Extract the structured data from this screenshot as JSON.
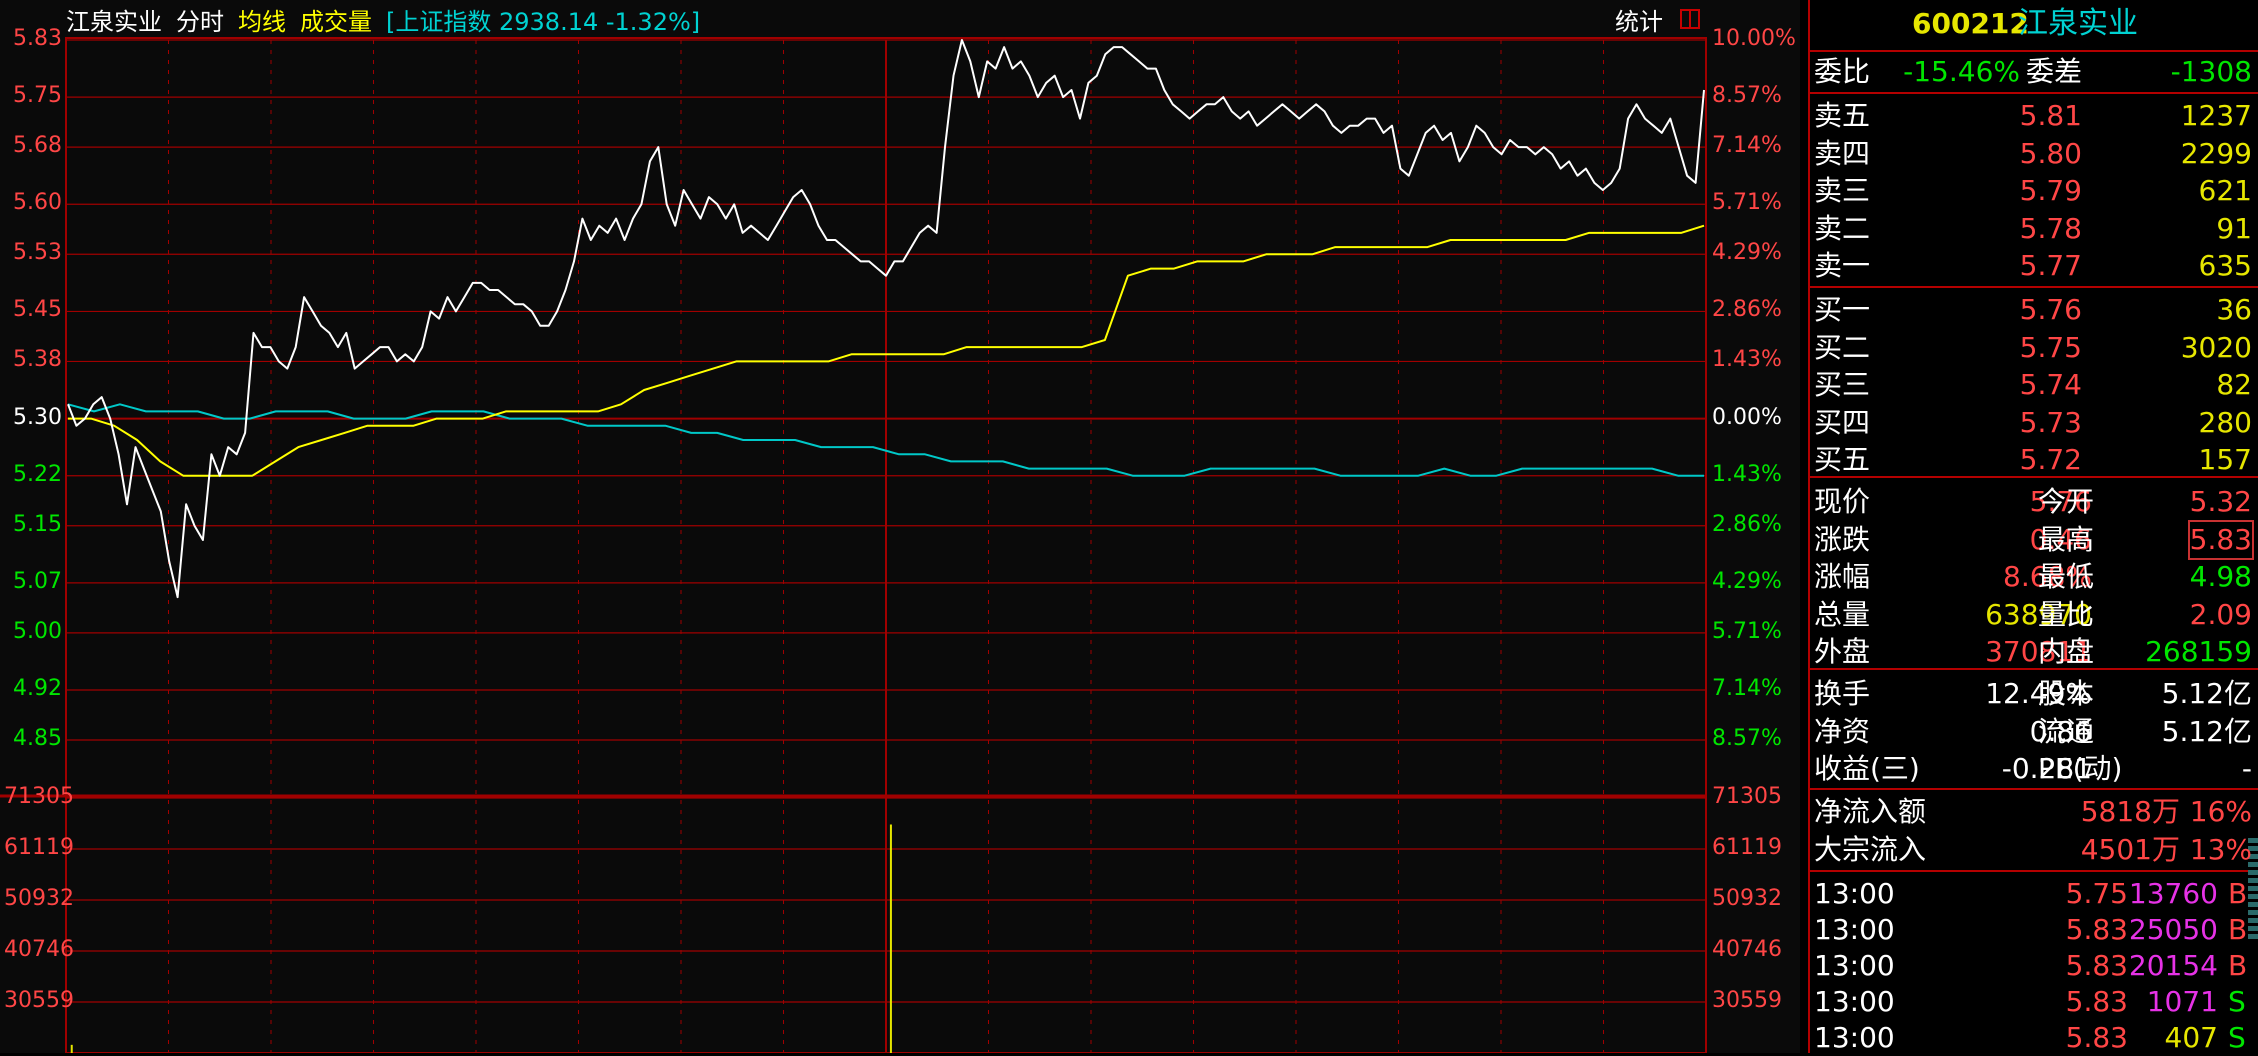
{
  "header": {
    "name": "江泉实业",
    "mode": "分时",
    "avg_label": "均线",
    "vol_label": "成交量",
    "index_text": "[上证指数 2938.14 -1.32%]",
    "tongji": "统计"
  },
  "colors": {
    "up": "#ff4646",
    "down": "#00e600",
    "price_line": "#ffffff",
    "avg_line": "#ffff00",
    "index_line": "#00c8c8",
    "grid": "#a00000",
    "volume_bar": "#e6e600"
  },
  "chart_data": [
    {
      "type": "line",
      "y_left_ticks": [
        "5.83",
        "5.75",
        "5.68",
        "5.60",
        "5.53",
        "5.45",
        "5.38",
        "5.30",
        "5.22",
        "5.15",
        "5.07",
        "5.00",
        "4.92",
        "4.85"
      ],
      "y_right_ticks": [
        "10.00%",
        "8.57%",
        "7.14%",
        "5.71%",
        "4.29%",
        "2.86%",
        "1.43%",
        "0.00%",
        "1.43%",
        "2.86%",
        "4.29%",
        "5.71%",
        "7.14%",
        "8.57%"
      ],
      "ylim": [
        4.85,
        5.83
      ],
      "base_price": 5.3,
      "x_sessions": "09:30-11:30,13:00-15:00",
      "series": [
        {
          "name": "分时",
          "color": "#ffffff",
          "values": [
            5.32,
            5.29,
            5.3,
            5.32,
            5.33,
            5.3,
            5.25,
            5.18,
            5.26,
            5.23,
            5.2,
            5.17,
            5.1,
            5.05,
            5.18,
            5.15,
            5.13,
            5.25,
            5.22,
            5.26,
            5.25,
            5.28,
            5.42,
            5.4,
            5.4,
            5.38,
            5.37,
            5.4,
            5.47,
            5.45,
            5.43,
            5.42,
            5.4,
            5.42,
            5.37,
            5.38,
            5.39,
            5.4,
            5.4,
            5.38,
            5.39,
            5.38,
            5.4,
            5.45,
            5.44,
            5.47,
            5.45,
            5.47,
            5.49,
            5.49,
            5.48,
            5.48,
            5.47,
            5.46,
            5.46,
            5.45,
            5.43,
            5.43,
            5.45,
            5.48,
            5.52,
            5.58,
            5.55,
            5.57,
            5.56,
            5.58,
            5.55,
            5.58,
            5.6,
            5.66,
            5.68,
            5.6,
            5.57,
            5.62,
            5.6,
            5.58,
            5.61,
            5.6,
            5.58,
            5.6,
            5.56,
            5.57,
            5.56,
            5.55,
            5.57,
            5.59,
            5.61,
            5.62,
            5.6,
            5.57,
            5.55,
            5.55,
            5.54,
            5.53,
            5.52,
            5.52,
            5.51,
            5.5,
            5.52,
            5.52,
            5.54,
            5.56,
            5.57,
            5.56,
            5.68,
            5.78,
            5.83,
            5.8,
            5.75,
            5.8,
            5.79,
            5.82,
            5.79,
            5.8,
            5.78,
            5.75,
            5.77,
            5.78,
            5.75,
            5.76,
            5.72,
            5.77,
            5.78,
            5.81,
            5.82,
            5.82,
            5.81,
            5.8,
            5.79,
            5.79,
            5.76,
            5.74,
            5.73,
            5.72,
            5.73,
            5.74,
            5.74,
            5.75,
            5.73,
            5.72,
            5.73,
            5.71,
            5.72,
            5.73,
            5.74,
            5.73,
            5.72,
            5.73,
            5.74,
            5.73,
            5.71,
            5.7,
            5.71,
            5.71,
            5.72,
            5.72,
            5.7,
            5.71,
            5.65,
            5.64,
            5.67,
            5.7,
            5.71,
            5.69,
            5.7,
            5.66,
            5.68,
            5.71,
            5.7,
            5.68,
            5.67,
            5.69,
            5.68,
            5.68,
            5.67,
            5.68,
            5.67,
            5.65,
            5.66,
            5.64,
            5.65,
            5.63,
            5.62,
            5.63,
            5.65,
            5.72,
            5.74,
            5.72,
            5.71,
            5.7,
            5.72,
            5.68,
            5.64,
            5.63,
            5.76
          ]
        },
        {
          "name": "均线",
          "color": "#ffff00",
          "values": [
            5.3,
            5.3,
            5.29,
            5.27,
            5.24,
            5.22,
            5.22,
            5.22,
            5.22,
            5.24,
            5.26,
            5.27,
            5.28,
            5.29,
            5.29,
            5.29,
            5.3,
            5.3,
            5.3,
            5.31,
            5.31,
            5.31,
            5.31,
            5.31,
            5.32,
            5.34,
            5.35,
            5.36,
            5.37,
            5.38,
            5.38,
            5.38,
            5.38,
            5.38,
            5.39,
            5.39,
            5.39,
            5.39,
            5.39,
            5.4,
            5.4,
            5.4,
            5.4,
            5.4,
            5.4,
            5.41,
            5.5,
            5.51,
            5.51,
            5.52,
            5.52,
            5.52,
            5.53,
            5.53,
            5.53,
            5.54,
            5.54,
            5.54,
            5.54,
            5.54,
            5.55,
            5.55,
            5.55,
            5.55,
            5.55,
            5.55,
            5.56,
            5.56,
            5.56,
            5.56,
            5.56,
            5.57
          ]
        },
        {
          "name": "上证指数",
          "color": "#00c8c8",
          "values": [
            5.32,
            5.31,
            5.32,
            5.31,
            5.31,
            5.31,
            5.3,
            5.3,
            5.31,
            5.31,
            5.31,
            5.3,
            5.3,
            5.3,
            5.31,
            5.31,
            5.31,
            5.3,
            5.3,
            5.3,
            5.29,
            5.29,
            5.29,
            5.29,
            5.28,
            5.28,
            5.27,
            5.27,
            5.27,
            5.26,
            5.26,
            5.26,
            5.25,
            5.25,
            5.24,
            5.24,
            5.24,
            5.23,
            5.23,
            5.23,
            5.23,
            5.22,
            5.22,
            5.22,
            5.23,
            5.23,
            5.23,
            5.23,
            5.23,
            5.22,
            5.22,
            5.22,
            5.22,
            5.23,
            5.22,
            5.22,
            5.23,
            5.23,
            5.23,
            5.23,
            5.23,
            5.23,
            5.22,
            5.22
          ]
        }
      ]
    },
    {
      "type": "bar",
      "y_left_ticks": [
        "71305",
        "61119",
        "50932",
        "40746",
        "30559"
      ],
      "y_right_ticks": [
        "71305",
        "61119",
        "50932",
        "40746",
        "30559"
      ],
      "ylim": [
        20373,
        71305
      ],
      "bars": [
        {
          "x": 0.0035,
          "value": 22000
        },
        {
          "x": 0.503,
          "value": 66000
        }
      ]
    }
  ],
  "panel": {
    "code": "600212",
    "name": "江泉实业",
    "weibi_label": "委比",
    "weibi": "-15.46%",
    "weicha_label": "委差",
    "weicha": "-1308",
    "sell": [
      {
        "label": "卖五",
        "price": "5.81",
        "vol": "1237"
      },
      {
        "label": "卖四",
        "price": "5.80",
        "vol": "2299"
      },
      {
        "label": "卖三",
        "price": "5.79",
        "vol": "621"
      },
      {
        "label": "卖二",
        "price": "5.78",
        "vol": "91"
      },
      {
        "label": "卖一",
        "price": "5.77",
        "vol": "635"
      }
    ],
    "buy": [
      {
        "label": "买一",
        "price": "5.76",
        "vol": "36"
      },
      {
        "label": "买二",
        "price": "5.75",
        "vol": "3020"
      },
      {
        "label": "买三",
        "price": "5.74",
        "vol": "82"
      },
      {
        "label": "买四",
        "price": "5.73",
        "vol": "280"
      },
      {
        "label": "买五",
        "price": "5.72",
        "vol": "157"
      }
    ],
    "quote": [
      {
        "l1": "现价",
        "v1": "5.76",
        "l2": "今开",
        "v2": "5.32"
      },
      {
        "l1": "涨跌",
        "v1": "0.46",
        "l2": "最高",
        "v2": "5.83"
      },
      {
        "l1": "涨幅",
        "v1": "8.68%",
        "l2": "最低",
        "v2": "4.98"
      },
      {
        "l1": "总量",
        "v1": "638970",
        "l2": "量比",
        "v2": "2.09"
      },
      {
        "l1": "外盘",
        "v1": "370811",
        "l2": "内盘",
        "v2": "268159"
      }
    ],
    "stats": [
      {
        "l1": "换手",
        "v1": "12.49%",
        "l2": "股本",
        "v2": "5.12亿"
      },
      {
        "l1": "净资",
        "v1": "0.86",
        "l2": "流通",
        "v2": "5.12亿"
      },
      {
        "l1": "收益(三)",
        "v1": "-0.281",
        "l2": "PE(动)",
        "v2": "-"
      }
    ],
    "flow": [
      {
        "label": "净流入额",
        "amount": "5818万",
        "pct": "16%"
      },
      {
        "label": "大宗流入",
        "amount": "4501万",
        "pct": "13%"
      }
    ],
    "ticks": [
      {
        "time": "13:00",
        "price": "5.75",
        "vol": "13760",
        "side": "B"
      },
      {
        "time": "13:00",
        "price": "5.83",
        "vol": "25050",
        "side": "B"
      },
      {
        "time": "13:00",
        "price": "5.83",
        "vol": "20154",
        "side": "B"
      },
      {
        "time": "13:00",
        "price": "5.83",
        "vol": "1071",
        "side": "S"
      },
      {
        "time": "13:00",
        "price": "5.83",
        "vol": "407",
        "side": "S"
      }
    ]
  }
}
